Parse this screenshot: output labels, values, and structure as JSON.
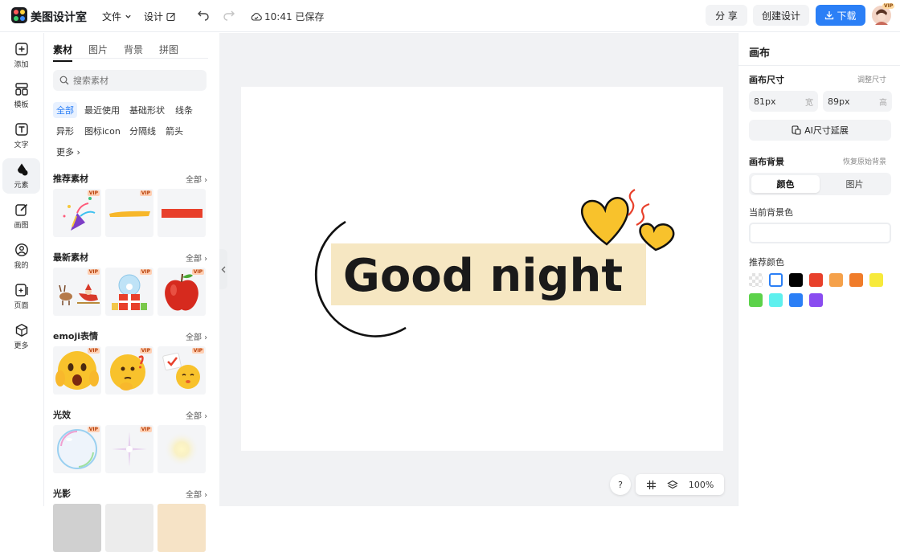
{
  "app": {
    "name": "美图设计室",
    "avatar_badge": "VIP"
  },
  "topbar": {
    "file_label": "文件",
    "design_label": "设计",
    "save_status": "10:41 已保存",
    "share_label": "分 享",
    "create_label": "创建设计",
    "download_label": "下载"
  },
  "rail": {
    "items": [
      {
        "label": "添加",
        "icon": "plus-square-icon"
      },
      {
        "label": "模板",
        "icon": "layout-icon"
      },
      {
        "label": "文字",
        "icon": "text-icon"
      },
      {
        "label": "元素",
        "icon": "shapes-icon"
      },
      {
        "label": "画图",
        "icon": "pencil-icon"
      },
      {
        "label": "我的",
        "icon": "user-icon"
      },
      {
        "label": "页面",
        "icon": "page-add-icon"
      },
      {
        "label": "更多",
        "icon": "cube-icon"
      }
    ]
  },
  "panel": {
    "tabs": [
      {
        "label": "素材"
      },
      {
        "label": "图片"
      },
      {
        "label": "背景"
      },
      {
        "label": "拼图"
      }
    ],
    "search_placeholder": "搜索素材",
    "chips": [
      {
        "label": "全部"
      },
      {
        "label": "最近使用"
      },
      {
        "label": "基础形状"
      },
      {
        "label": "线条"
      },
      {
        "label": "异形"
      },
      {
        "label": "图标icon"
      },
      {
        "label": "分隔线"
      },
      {
        "label": "箭头"
      },
      {
        "label": "更多 ›"
      }
    ],
    "vip_label": "VIP",
    "all_label": "全部 ›",
    "sections": [
      {
        "title": "推荐素材"
      },
      {
        "title": "最新素材"
      },
      {
        "title": "emoji表情"
      },
      {
        "title": "光效"
      },
      {
        "title": "光影"
      }
    ]
  },
  "canvas": {
    "text": "Good night",
    "colors": {
      "moon": "#f8c22c",
      "heart": "#f8c22c",
      "text_bg": "#f6e7c2"
    }
  },
  "bottom": {
    "help": "?",
    "zoom": "100%"
  },
  "right": {
    "title": "画布",
    "size_label": "画布尺寸",
    "resize_link": "调整尺寸",
    "width_value": "81px",
    "width_unit": "宽",
    "height_value": "89px",
    "height_unit": "高",
    "ai_button": "AI尺寸延展",
    "bg_label": "画布背景",
    "restore_link": "恢复原始背景",
    "seg_color": "颜色",
    "seg_image": "图片",
    "current_bg_label": "当前背景色",
    "recommend_label": "推荐颜色",
    "swatches": [
      "transparent",
      "#ffffff",
      "#000000",
      "#e8402b",
      "#f5a14a",
      "#f07c2a",
      "#f7ea3b",
      "#5cd24a",
      "#5ef0ee",
      "#2b7ff6",
      "#8a4cf0"
    ]
  },
  "colors": {
    "accent": "#2b7ff6"
  }
}
